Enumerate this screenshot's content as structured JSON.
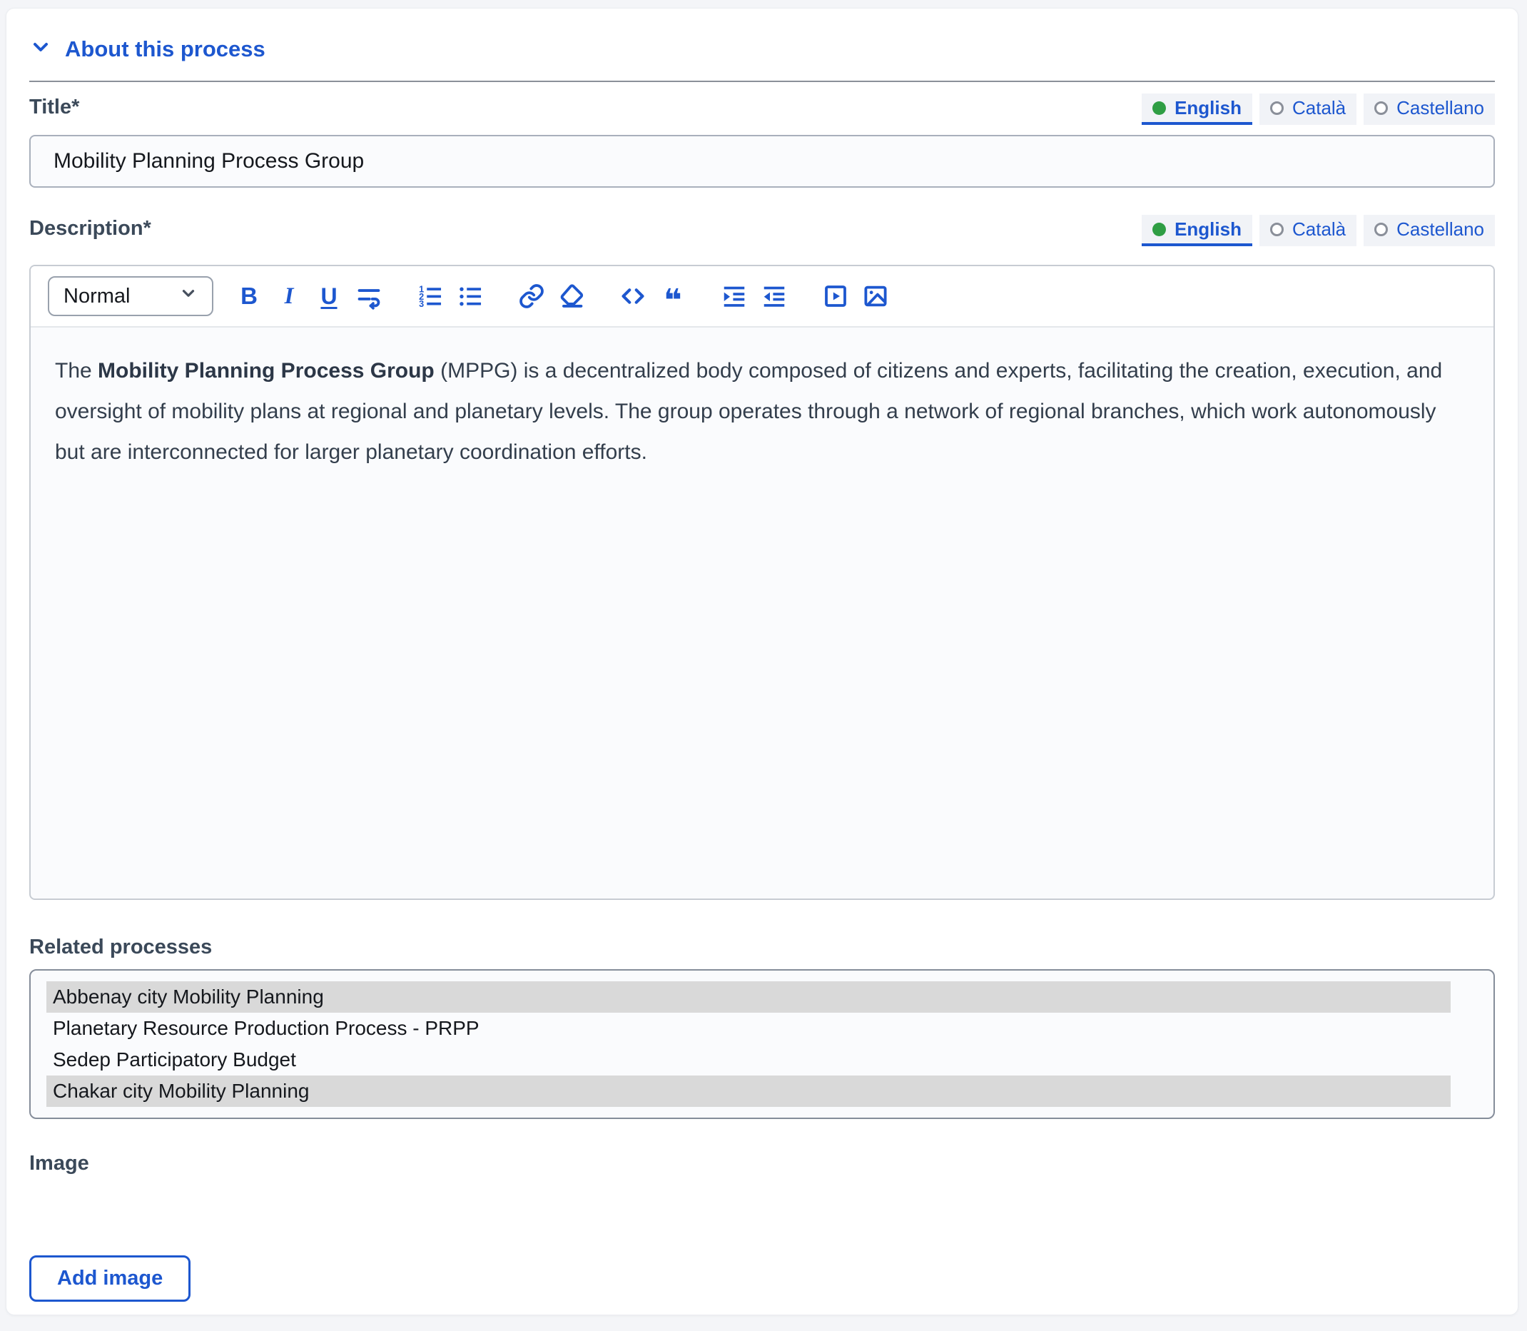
{
  "colors": {
    "accent_blue": "#1d57cf",
    "label_slate": "#3b4959",
    "active_dot_green": "#2f9e44",
    "selected_option_bg": "#d9d9d9"
  },
  "section": {
    "title": "About this process"
  },
  "language_tabs": [
    {
      "label": "English",
      "active": true
    },
    {
      "label": "Català",
      "active": false
    },
    {
      "label": "Castellano",
      "active": false
    }
  ],
  "title_field": {
    "label": "Title*",
    "value": "Mobility Planning Process Group"
  },
  "description_field": {
    "label": "Description*",
    "format_label": "Normal",
    "toolbar_glyphs": {
      "bold": "B",
      "italic": "I",
      "underline": "U",
      "blockquote": "❝"
    },
    "toolbar_icons": [
      "bold",
      "italic",
      "underline",
      "soft-wrap",
      "ordered-list",
      "bullet-list",
      "link",
      "clear-formatting",
      "code-block",
      "blockquote",
      "indent",
      "outdent",
      "video",
      "image"
    ],
    "content": {
      "prefix": "The ",
      "bold": "Mobility Planning Process Group",
      "rest": " (MPPG) is a decentralized body composed of citizens and experts, facilitating the creation, execution, and oversight of mobility plans at regional and planetary levels. The group operates through a network of regional branches, which work autonomously but are interconnected for larger planetary coordination efforts."
    }
  },
  "related_processes": {
    "label": "Related processes",
    "options": [
      {
        "label": "Abbenay city Mobility Planning",
        "selected": true
      },
      {
        "label": "Planetary Resource Production Process - PRPP",
        "selected": false
      },
      {
        "label": "Sedep Participatory Budget",
        "selected": false
      },
      {
        "label": "Chakar city Mobility Planning",
        "selected": true
      }
    ]
  },
  "image_field": {
    "label": "Image",
    "add_button_label": "Add image"
  }
}
